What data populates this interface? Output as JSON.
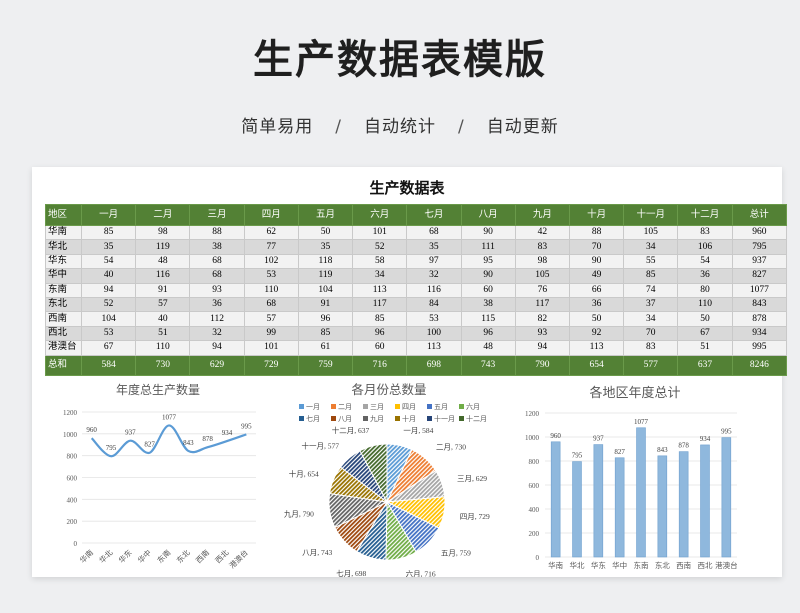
{
  "hero": {
    "title": "生产数据表模版",
    "features": [
      "简单易用",
      "自动统计",
      "自动更新"
    ],
    "separator": "/"
  },
  "sheet": {
    "title": "生产数据表",
    "header": [
      "地区",
      "一月",
      "二月",
      "三月",
      "四月",
      "五月",
      "六月",
      "七月",
      "八月",
      "九月",
      "十月",
      "十一月",
      "十二月",
      "总计"
    ],
    "rows": [
      [
        "华南",
        "85",
        "98",
        "88",
        "62",
        "50",
        "101",
        "68",
        "90",
        "42",
        "88",
        "105",
        "83",
        "960"
      ],
      [
        "华北",
        "35",
        "119",
        "38",
        "77",
        "35",
        "52",
        "35",
        "111",
        "83",
        "70",
        "34",
        "106",
        "795"
      ],
      [
        "华东",
        "54",
        "48",
        "68",
        "102",
        "118",
        "58",
        "97",
        "95",
        "98",
        "90",
        "55",
        "54",
        "937"
      ],
      [
        "华中",
        "40",
        "116",
        "68",
        "53",
        "119",
        "34",
        "32",
        "90",
        "105",
        "49",
        "85",
        "36",
        "827"
      ],
      [
        "东南",
        "94",
        "91",
        "93",
        "110",
        "104",
        "113",
        "116",
        "60",
        "76",
        "66",
        "74",
        "80",
        "1077"
      ],
      [
        "东北",
        "52",
        "57",
        "36",
        "68",
        "91",
        "117",
        "84",
        "38",
        "117",
        "36",
        "37",
        "110",
        "843"
      ],
      [
        "西南",
        "104",
        "40",
        "112",
        "57",
        "96",
        "85",
        "53",
        "115",
        "82",
        "50",
        "34",
        "50",
        "878"
      ],
      [
        "西北",
        "53",
        "51",
        "32",
        "99",
        "85",
        "96",
        "100",
        "96",
        "93",
        "92",
        "70",
        "67",
        "934"
      ],
      [
        "港澳台",
        "67",
        "110",
        "94",
        "101",
        "61",
        "60",
        "113",
        "48",
        "94",
        "113",
        "83",
        "51",
        "995"
      ]
    ],
    "total": [
      "总和",
      "584",
      "730",
      "629",
      "729",
      "759",
      "716",
      "698",
      "743",
      "790",
      "654",
      "577",
      "637",
      "8246"
    ]
  },
  "colors": {
    "header_green": "#538135",
    "row_light": "#f2f2f2",
    "row_dark": "#d9d9d9",
    "line_blue": "#5b9bd5",
    "bar_blue": "#8fb8dd"
  },
  "chart_data": [
    {
      "type": "line",
      "title": "年度总生产数量",
      "categories": [
        "华南",
        "华北",
        "华东",
        "华中",
        "东南",
        "东北",
        "西南",
        "西北",
        "港澳台"
      ],
      "values": [
        960,
        795,
        937,
        827,
        1077,
        843,
        878,
        934,
        995
      ],
      "ylim": [
        0,
        1200
      ],
      "yticks": [
        0,
        200,
        400,
        600,
        800,
        1000,
        1200
      ],
      "grid": true,
      "smooth": true
    },
    {
      "type": "pie",
      "title": "各月份总数量",
      "categories": [
        "一月",
        "二月",
        "三月",
        "四月",
        "五月",
        "六月",
        "七月",
        "八月",
        "九月",
        "十月",
        "十一月",
        "十二月"
      ],
      "values": [
        584,
        730,
        629,
        729,
        759,
        716,
        698,
        743,
        790,
        654,
        577,
        637
      ],
      "colors": [
        "#5b9bd5",
        "#ed7d31",
        "#a5a5a5",
        "#ffc000",
        "#4472c4",
        "#70ad47",
        "#255e91",
        "#9e480e",
        "#636363",
        "#997300",
        "#264478",
        "#43682b"
      ],
      "legend": "top",
      "pattern": "hatched"
    },
    {
      "type": "bar",
      "title": "各地区年度总计",
      "categories": [
        "华南",
        "华北",
        "华东",
        "华中",
        "东南",
        "东北",
        "西南",
        "西北",
        "港澳台"
      ],
      "values": [
        960,
        795,
        937,
        827,
        1077,
        843,
        878,
        934,
        995
      ],
      "ylim": [
        0,
        1200
      ],
      "yticks": [
        0,
        200,
        400,
        600,
        800,
        1000,
        1200
      ],
      "grid": true
    }
  ]
}
